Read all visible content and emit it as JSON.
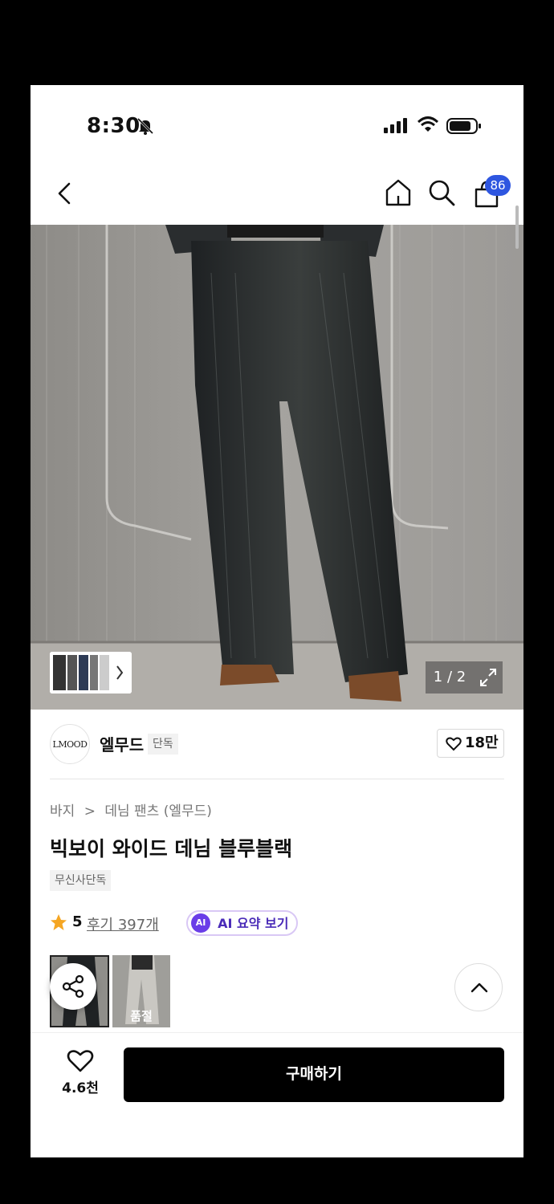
{
  "status_bar": {
    "time": "8:30"
  },
  "nav": {
    "cart_badge": "86"
  },
  "hero": {
    "counter": "1 / 2"
  },
  "brand": {
    "logo_text": "LMOOD",
    "name": "엘무드",
    "tag": "단독",
    "likes": "18만"
  },
  "product": {
    "breadcrumb_category": "바지",
    "breadcrumb_separator": ">",
    "breadcrumb_sub": "데님 팬츠 (엘무드)",
    "title": "빅보이 와이드 데님 블루블랙",
    "exclusive_tag": "무신사단독",
    "rating": "5",
    "reviews": "후기 397개",
    "ai_badge": "AI",
    "ai_label": "AI 요약 보기",
    "soldout_label": "품절"
  },
  "bottom_bar": {
    "fav_count": "4.6천",
    "buy_label": "구매하기"
  },
  "colors": {
    "accent_badge": "#2e56e0",
    "ai_purple": "#6a3de8",
    "buy_button": "#000000"
  }
}
